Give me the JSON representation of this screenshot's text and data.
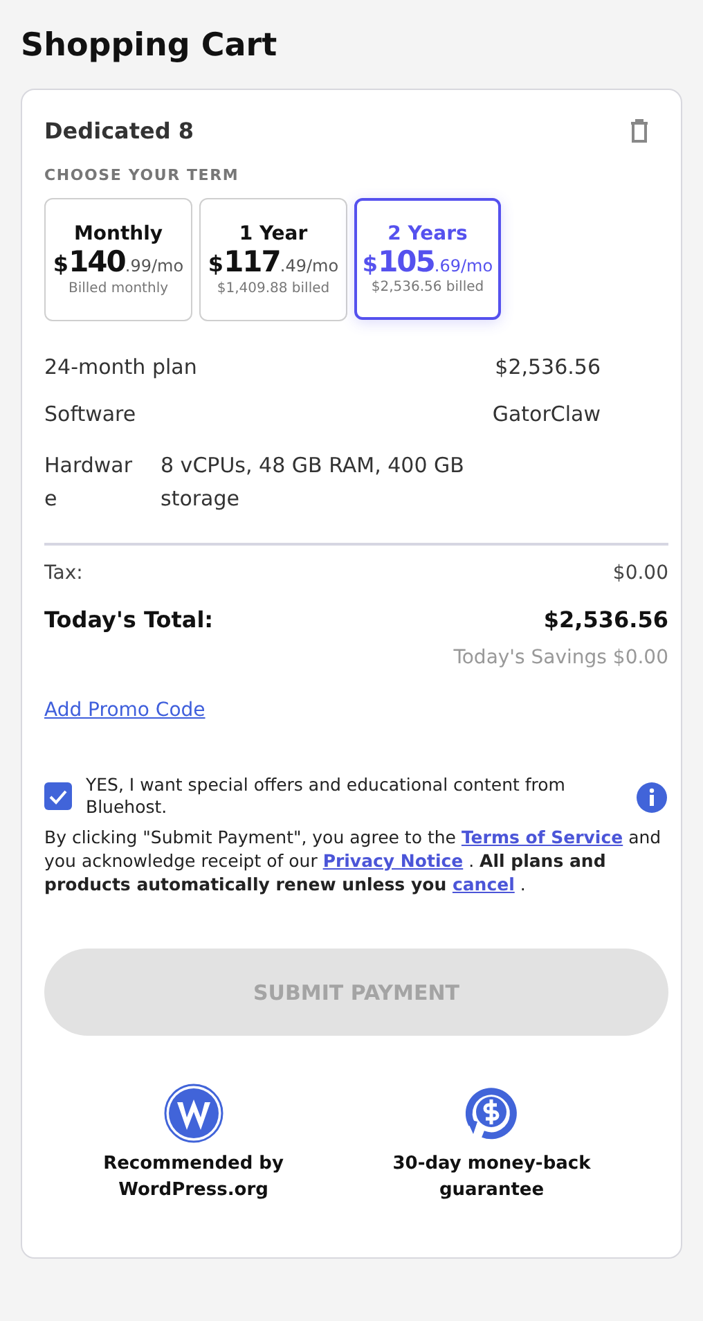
{
  "page_title": "Shopping Cart",
  "product": {
    "name": "Dedicated 8",
    "term_label": "CHOOSE YOUR TERM",
    "terms": [
      {
        "label": "Monthly",
        "currency": "$",
        "whole": "140",
        "fraction": ".99/mo",
        "billed": "Billed monthly",
        "selected": false
      },
      {
        "label": "1 Year",
        "currency": "$",
        "whole": "117",
        "fraction": ".49/mo",
        "billed": "$1,409.88 billed",
        "selected": false
      },
      {
        "label": "2 Years",
        "currency": "$",
        "whole": "105",
        "fraction": ".69/mo",
        "billed": "$2,536.56 billed",
        "selected": true
      }
    ],
    "details": [
      {
        "label": "24-month plan",
        "value": "$2,536.56"
      },
      {
        "label": "Software",
        "value": "GatorClaw"
      },
      {
        "label": "Hardware",
        "value": "8 vCPUs, 48 GB RAM, 400 GB storage"
      }
    ]
  },
  "tax": {
    "label": "Tax:",
    "value": "$0.00"
  },
  "total": {
    "label": "Today's Total:",
    "value": "$2,536.56"
  },
  "savings": "Today's Savings $0.00",
  "promo_link": "Add Promo Code",
  "offers": {
    "checked": true,
    "text": "YES, I want special offers and educational content from Bluehost."
  },
  "legal": [
    {
      "kind": "plain",
      "text": " By clicking \"Submit Payment\", you agree to the "
    },
    {
      "kind": "link",
      "text": "Terms of Service"
    },
    {
      "kind": "plain",
      "text": " and you acknowledge receipt of our "
    },
    {
      "kind": "link",
      "text": "Privacy Notice"
    },
    {
      "kind": "plain",
      "text": " .  "
    },
    {
      "kind": "bold",
      "text": "All plans and products automatically renew unless you "
    },
    {
      "kind": "link",
      "text": "cancel"
    },
    {
      "kind": "plain",
      "text": " ."
    }
  ],
  "submit": {
    "label": "SUBMIT PAYMENT",
    "disabled": true
  },
  "badges": [
    {
      "kind": "wordpress",
      "text": "Recommended by WordPress.org"
    },
    {
      "kind": "money",
      "text": "30-day money-back guarantee"
    }
  ]
}
